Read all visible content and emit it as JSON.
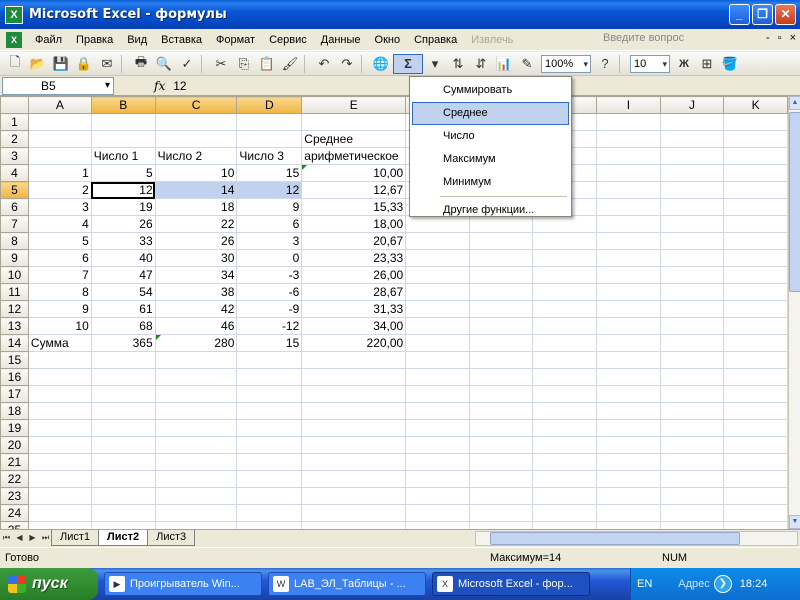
{
  "window": {
    "title": "Microsoft Excel - формулы",
    "app_icon": "X"
  },
  "menu": {
    "items": [
      "Файл",
      "Правка",
      "Вид",
      "Вставка",
      "Формат",
      "Сервис",
      "Данные",
      "Окно",
      "Справка",
      "Извлечь"
    ],
    "ask_placeholder": "Введите вопрос",
    "doc_controls": [
      "-",
      "▫",
      "×"
    ]
  },
  "toolbar": {
    "sigma": "Σ",
    "zoom": "100%",
    "font_size": "10",
    "bold": "Ж"
  },
  "formula_bar": {
    "name_box": "B5",
    "fx": "fx",
    "formula": "12"
  },
  "grid": {
    "columns": [
      "A",
      "B",
      "C",
      "D",
      "E",
      "F",
      "G",
      "H",
      "I",
      "J",
      "K"
    ],
    "rows": [
      {
        "n": "1",
        "cells": [
          "",
          "",
          "",
          "",
          ""
        ]
      },
      {
        "n": "2",
        "cells": [
          "",
          "",
          "",
          "",
          "Среднее"
        ]
      },
      {
        "n": "3",
        "cells": [
          "",
          "Число 1",
          "Число 2",
          "Число 3",
          "арифметическое"
        ]
      },
      {
        "n": "4",
        "cells": [
          "1",
          "5",
          "10",
          "15",
          "10,00"
        ]
      },
      {
        "n": "5",
        "cells": [
          "2",
          "12",
          "14",
          "12",
          "12,67"
        ]
      },
      {
        "n": "6",
        "cells": [
          "3",
          "19",
          "18",
          "9",
          "15,33"
        ]
      },
      {
        "n": "7",
        "cells": [
          "4",
          "26",
          "22",
          "6",
          "18,00"
        ]
      },
      {
        "n": "8",
        "cells": [
          "5",
          "33",
          "26",
          "3",
          "20,67"
        ]
      },
      {
        "n": "9",
        "cells": [
          "6",
          "40",
          "30",
          "0",
          "23,33"
        ]
      },
      {
        "n": "10",
        "cells": [
          "7",
          "47",
          "34",
          "-3",
          "26,00"
        ]
      },
      {
        "n": "11",
        "cells": [
          "8",
          "54",
          "38",
          "-6",
          "28,67"
        ]
      },
      {
        "n": "12",
        "cells": [
          "9",
          "61",
          "42",
          "-9",
          "31,33"
        ]
      },
      {
        "n": "13",
        "cells": [
          "10",
          "68",
          "46",
          "-12",
          "34,00"
        ]
      },
      {
        "n": "14",
        "cells": [
          "Сумма",
          "365",
          "280",
          "15",
          "220,00"
        ]
      },
      {
        "n": "15",
        "cells": [
          "",
          "",
          "",
          "",
          ""
        ]
      },
      {
        "n": "16",
        "cells": [
          "",
          "",
          "",
          "",
          ""
        ]
      },
      {
        "n": "17",
        "cells": [
          "",
          "",
          "",
          "",
          ""
        ]
      },
      {
        "n": "18",
        "cells": [
          "",
          "",
          "",
          "",
          ""
        ]
      },
      {
        "n": "19",
        "cells": [
          "",
          "",
          "",
          "",
          ""
        ]
      },
      {
        "n": "20",
        "cells": [
          "",
          "",
          "",
          "",
          ""
        ]
      },
      {
        "n": "21",
        "cells": [
          "",
          "",
          "",
          "",
          ""
        ]
      },
      {
        "n": "22",
        "cells": [
          "",
          "",
          "",
          "",
          ""
        ]
      },
      {
        "n": "23",
        "cells": [
          "",
          "",
          "",
          "",
          ""
        ]
      },
      {
        "n": "24",
        "cells": [
          "",
          "",
          "",
          "",
          ""
        ]
      },
      {
        "n": "25",
        "cells": [
          "",
          "",
          "",
          "",
          ""
        ]
      }
    ]
  },
  "sheets": {
    "tabs": [
      "Лист1",
      "Лист2",
      "Лист3"
    ],
    "active": "Лист2"
  },
  "status": {
    "ready": "Готово",
    "summary": "Максимум=14",
    "num": "NUM"
  },
  "dropdown": {
    "items": [
      "Суммировать",
      "Среднее",
      "Число",
      "Максимум",
      "Минимум"
    ],
    "other": "Другие функции...",
    "highlighted": "Среднее"
  },
  "taskbar": {
    "start": "пуск",
    "buttons": [
      "Проигрыватель Win...",
      "LAB_ЭЛ_Таблицы - ...",
      "Microsoft Excel - фор..."
    ],
    "lang": "EN",
    "address": "Адрес",
    "clock": "18:24"
  },
  "colors": {
    "selection": "#c1d2ee",
    "title_blue": "#0858d6",
    "start_green": "#2f8b2f"
  }
}
